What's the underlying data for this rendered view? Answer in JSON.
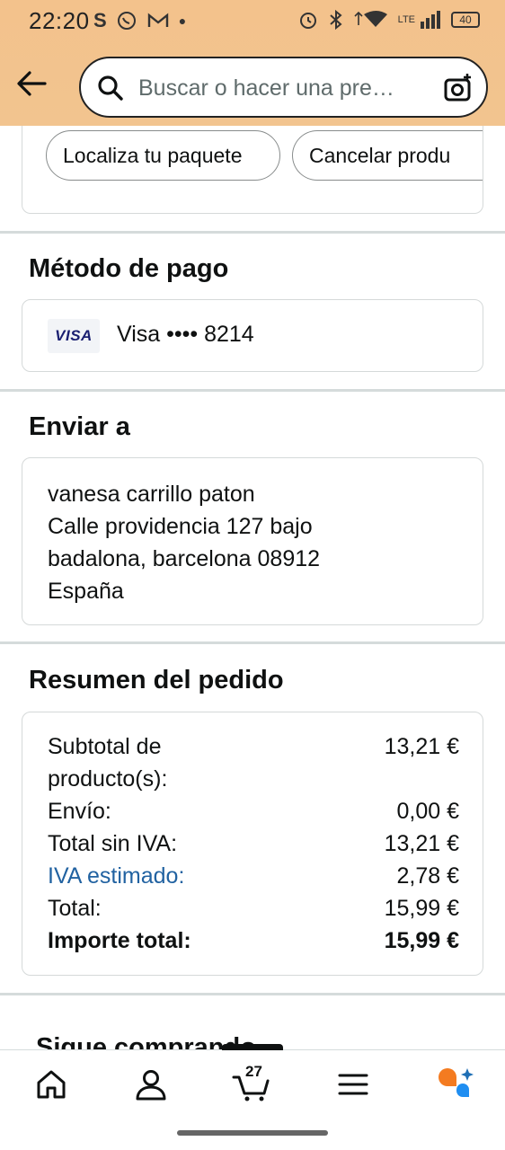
{
  "status_bar": {
    "time": "22:20",
    "left_icons": [
      "s-icon",
      "whatsapp-icon",
      "gmail-icon",
      "dot-icon"
    ],
    "right_icons": [
      "alarm-icon",
      "bluetooth-icon",
      "wifi-icon",
      "lte-signal-icon"
    ],
    "network": "LTE",
    "battery": "40"
  },
  "header": {
    "search_placeholder": "Buscar o hacer una pre…",
    "colors": {
      "header_bg": "#f3c38c"
    }
  },
  "actions": {
    "locate_package": "Localiza tu paquete",
    "cancel_products": "Cancelar produ"
  },
  "payment": {
    "title": "Método de pago",
    "card_brand": "VISA",
    "card_text": "Visa •••• 8214"
  },
  "shipping": {
    "title": "Enviar a",
    "lines": [
      "vanesa carrillo paton",
      "Calle providencia 127 bajo",
      "badalona, barcelona 08912",
      "España"
    ]
  },
  "summary": {
    "title": "Resumen del pedido",
    "rows": [
      {
        "label": "Subtotal de",
        "label2": "producto(s):",
        "value": "13,21 €"
      },
      {
        "label": "Envío:",
        "value": "0,00 €"
      },
      {
        "label": "Total sin IVA:",
        "value": "13,21 €"
      },
      {
        "label": "IVA estimado:",
        "value": "2,78 €"
      },
      {
        "label": "Total:",
        "value": "15,99 €"
      },
      {
        "label": "Importe total:",
        "value": "15,99 €"
      }
    ],
    "colors": {
      "link": "#2162a1"
    }
  },
  "cut_section_title": "Sigue comprando",
  "bottom_nav": {
    "items": [
      "home-icon",
      "account-icon",
      "cart-icon",
      "menu-icon",
      "rufus-icon"
    ],
    "cart_count": "27"
  }
}
